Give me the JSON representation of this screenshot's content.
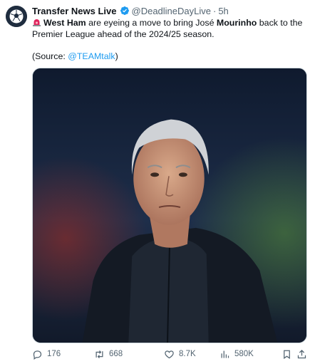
{
  "tweet": {
    "author_name": "Transfer News Live",
    "handle": "@DeadlineDayLive",
    "separator": "·",
    "time": "5h",
    "text_part1": "West Ham",
    "text_part2": " are eyeing a move to bring José ",
    "text_part3": "Mourinho",
    "text_part4": " back to the Premier League ahead of the 2024/25 season.",
    "source_prefix": "(Source: ",
    "source_mention": "@TEAMtalk",
    "source_suffix": ")",
    "media_icon": "photo-of-man-in-dark-coat"
  },
  "actions": {
    "replies": "176",
    "retweets": "668",
    "likes": "8.7K",
    "views": "580K"
  },
  "icons": {
    "avatar": "football-logo-icon",
    "verified": "verified-badge-icon",
    "siren": "siren-emoji-icon",
    "reply": "reply-icon",
    "retweet": "retweet-icon",
    "like": "heart-icon",
    "views": "views-chart-icon",
    "bookmark": "bookmark-icon",
    "share": "share-icon"
  },
  "colors": {
    "link": "#1d9bf0",
    "verified": "#1d9bf0",
    "muted": "#536471"
  }
}
